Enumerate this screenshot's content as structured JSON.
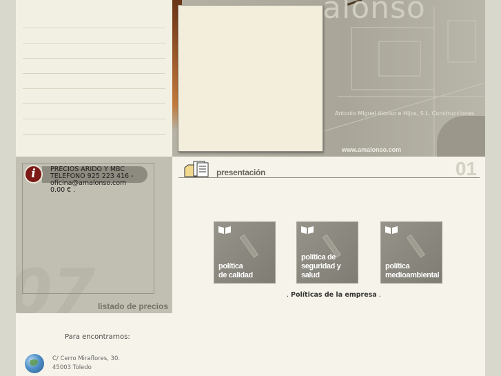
{
  "header": {
    "brand_watermark": "alonso",
    "company_name": "Antonio Miguel Alonso e Hijos, S.L. Construcciones",
    "website": "www.amalonso.com"
  },
  "price_list": {
    "title": "PRECIOS ARIDO Y MBC",
    "phone_line": "TELEFONO 925 223 416 -",
    "email_line": "oficina@amalonso.com",
    "price_line": "0.00 € .",
    "footer_link": "listado de precios",
    "info_icon_symbol": "i"
  },
  "section": {
    "title": "presentación",
    "number": "01"
  },
  "policies": {
    "tiles": [
      {
        "line1": "política",
        "line2": "de calidad"
      },
      {
        "line1": "política de",
        "line2": "seguridad y salud"
      },
      {
        "line1": "política",
        "line2": "medioambiental"
      }
    ],
    "caption_prefix": ". ",
    "caption_link": "Políticas de la empresa",
    "caption_suffix": " ."
  },
  "contact": {
    "title": "Para encontrarnos:",
    "address_line1": "C/ Cerro Miraflores, 30.",
    "address_line2": "45003 Toledo"
  },
  "colors": {
    "background": "#d9d8cd",
    "info_icon": "#7b1a16",
    "tile_bg": "#8a877d"
  }
}
